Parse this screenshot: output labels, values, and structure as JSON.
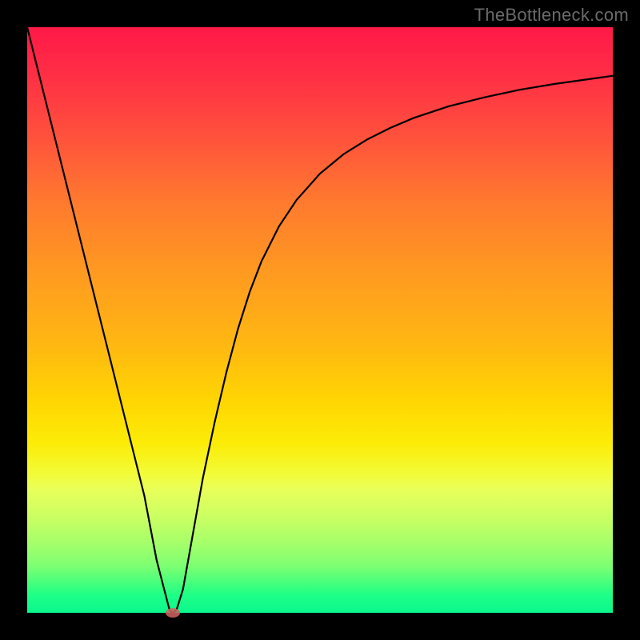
{
  "watermark": "TheBottleneck.com",
  "chart_data": {
    "type": "line",
    "title": "",
    "xlabel": "",
    "ylabel": "",
    "xlim": [
      0,
      1
    ],
    "ylim": [
      0,
      1
    ],
    "x": [
      0.0,
      0.02,
      0.05,
      0.08,
      0.11,
      0.14,
      0.17,
      0.2,
      0.221,
      0.243,
      0.248,
      0.255,
      0.266,
      0.283,
      0.3,
      0.32,
      0.34,
      0.36,
      0.38,
      0.4,
      0.43,
      0.46,
      0.5,
      0.54,
      0.58,
      0.62,
      0.66,
      0.72,
      0.78,
      0.84,
      0.9,
      0.95,
      1.0
    ],
    "y": [
      1.0,
      0.92,
      0.8,
      0.68,
      0.56,
      0.44,
      0.32,
      0.2,
      0.09,
      0.005,
      0.0,
      0.005,
      0.04,
      0.135,
      0.23,
      0.325,
      0.41,
      0.485,
      0.548,
      0.6,
      0.66,
      0.705,
      0.75,
      0.783,
      0.808,
      0.828,
      0.845,
      0.865,
      0.88,
      0.893,
      0.903,
      0.91,
      0.917
    ],
    "marker": {
      "x": 0.248,
      "y": 0.0
    },
    "background_gradient": {
      "top_color": "#ff1948",
      "bottom_color": "#0bf78d",
      "type": "vertical-red-to-green"
    },
    "curve_color": "#000000",
    "marker_color": "#d06560"
  }
}
